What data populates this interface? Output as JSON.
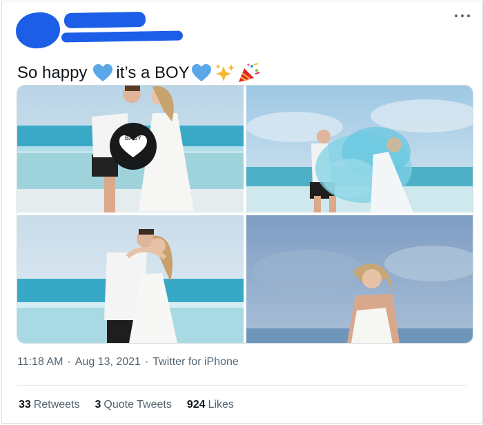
{
  "tweet": {
    "text_part1": "So happy",
    "text_part2": "it’s a BOY",
    "emoji_icons": [
      "blue-heart-icon",
      "blue-heart-icon",
      "sparkles-icon",
      "party-popper-icon"
    ],
    "time": "11:18 AM",
    "date": "Aug 13, 2021",
    "source": "Twitter for iPhone",
    "separator": "·",
    "more_icon": "ellipsis-icon"
  },
  "media": {
    "balloon_text": "BABY",
    "photos": [
      "photo-1",
      "photo-2",
      "photo-3",
      "photo-4"
    ]
  },
  "stats": {
    "retweets_count": "33",
    "retweets_label": "Retweets",
    "quotes_count": "3",
    "quotes_label": "Quote Tweets",
    "likes_count": "924",
    "likes_label": "Likes"
  },
  "colors": {
    "redaction": "#1d5ee6",
    "heart": "#5aa7e8",
    "text": "#0f1419",
    "muted": "#536471",
    "border": "#cfd9de"
  }
}
